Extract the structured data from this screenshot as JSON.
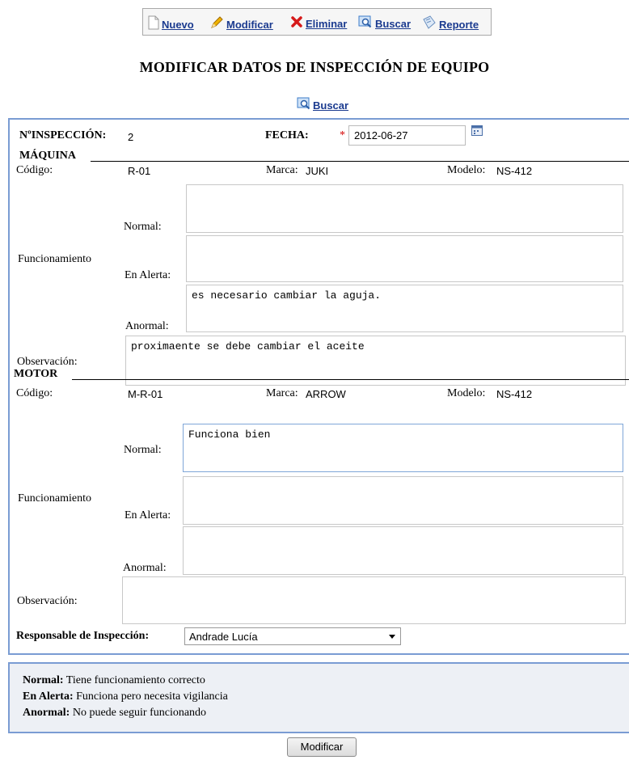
{
  "toolbar": {
    "nuevo": "Nuevo",
    "modificar": "Modificar",
    "eliminar": "Eliminar",
    "buscar": "Buscar",
    "reporte": "Reporte"
  },
  "page_title": "MODIFICAR DATOS DE INSPECCIÓN DE EQUIPO",
  "search_link": "Buscar",
  "header": {
    "inspection_label": "NºINSPECCIÓN:",
    "inspection_value": "2",
    "fecha_label": "FECHA:",
    "required_mark": "*",
    "fecha_value": "2012-06-27"
  },
  "maquina": {
    "section_title": "MÁQUINA",
    "codigo_label": "Código:",
    "codigo_value": "R-01",
    "marca_label": "Marca:",
    "marca_value": "JUKI",
    "modelo_label": "Modelo:",
    "modelo_value": "NS-412",
    "funcionamiento_label": "Funcionamiento",
    "normal_label": "Normal:",
    "normal_text": "",
    "alerta_label": "En Alerta:",
    "alerta_text": "",
    "anormal_label": "Anormal:",
    "anormal_text": "es necesario cambiar la aguja.",
    "observacion_label": "Observación:",
    "observacion_text": "proximaente se debe cambiar el aceite"
  },
  "motor": {
    "section_title": "MOTOR",
    "codigo_label": "Código:",
    "codigo_value": "M-R-01",
    "marca_label": "Marca:",
    "marca_value": "ARROW",
    "modelo_label": "Modelo:",
    "modelo_value": "NS-412",
    "funcionamiento_label": "Funcionamiento",
    "normal_label": "Normal:",
    "normal_text": "Funciona bien",
    "alerta_label": "En Alerta:",
    "alerta_text": "",
    "anormal_label": "Anormal:",
    "anormal_text": "",
    "observacion_label": "Observación:",
    "observacion_text": ""
  },
  "responsable": {
    "label": "Responsable de Inspección:",
    "value": "Andrade Lucía"
  },
  "legend": [
    {
      "term": "Normal:",
      "desc": "Tiene funcionamiento correcto"
    },
    {
      "term": "En Alerta:",
      "desc": "Funciona pero necesita vigilancia"
    },
    {
      "term": "Anormal:",
      "desc": "No puede seguir funcionando"
    }
  ],
  "submit_label": "Modificar",
  "colors": {
    "panel_border": "#7a9cd3",
    "link": "#1a3a8f",
    "required": "#d40000",
    "legend_bg": "#edf0f5"
  },
  "icons": {
    "nuevo": "new-document-icon",
    "modificar": "pencil-icon",
    "eliminar": "red-x-icon",
    "buscar": "magnifier-icon",
    "reporte": "report-icon",
    "calendar": "calendar-icon"
  }
}
